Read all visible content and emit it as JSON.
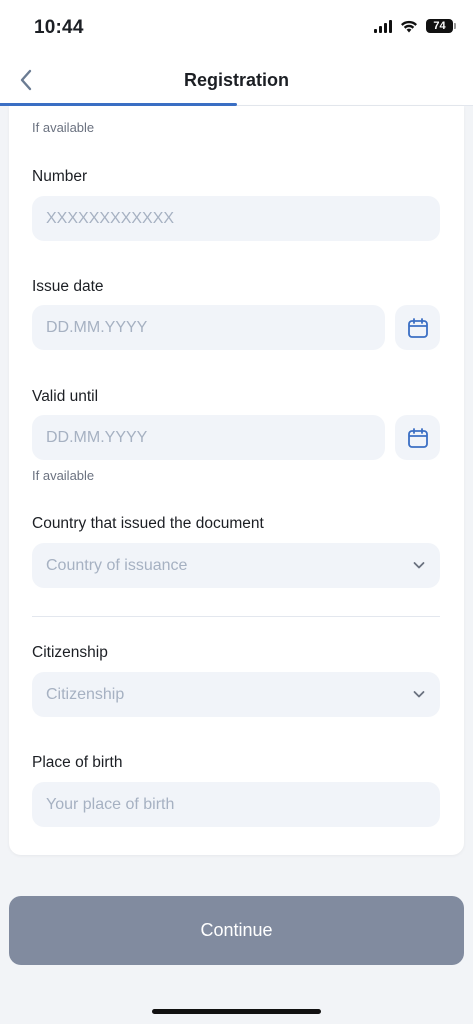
{
  "status": {
    "time": "10:44",
    "battery": "74"
  },
  "header": {
    "title": "Registration",
    "progress_fraction": 0.5
  },
  "form": {
    "top_hint": "If available",
    "number": {
      "label": "Number",
      "placeholder": "XXXXXXXXXXXX"
    },
    "issue_date": {
      "label": "Issue date",
      "placeholder": "DD.MM.YYYY"
    },
    "valid_until": {
      "label": "Valid until",
      "placeholder": "DD.MM.YYYY",
      "hint": "If available"
    },
    "issuing_country": {
      "label": "Country that issued the document",
      "placeholder": "Country of issuance"
    },
    "citizenship": {
      "label": "Citizenship",
      "placeholder": "Citizenship"
    },
    "place_of_birth": {
      "label": "Place of birth",
      "placeholder": "Your place of birth"
    }
  },
  "footer": {
    "continue_label": "Continue"
  },
  "colors": {
    "accent": "#3b6fc4",
    "button_disabled": "#818b9f",
    "field_bg": "#f1f4f9",
    "placeholder": "#a6b1c2"
  },
  "icons": {
    "back": "chevron-left-icon",
    "calendar": "calendar-icon",
    "dropdown": "chevron-down-icon"
  }
}
